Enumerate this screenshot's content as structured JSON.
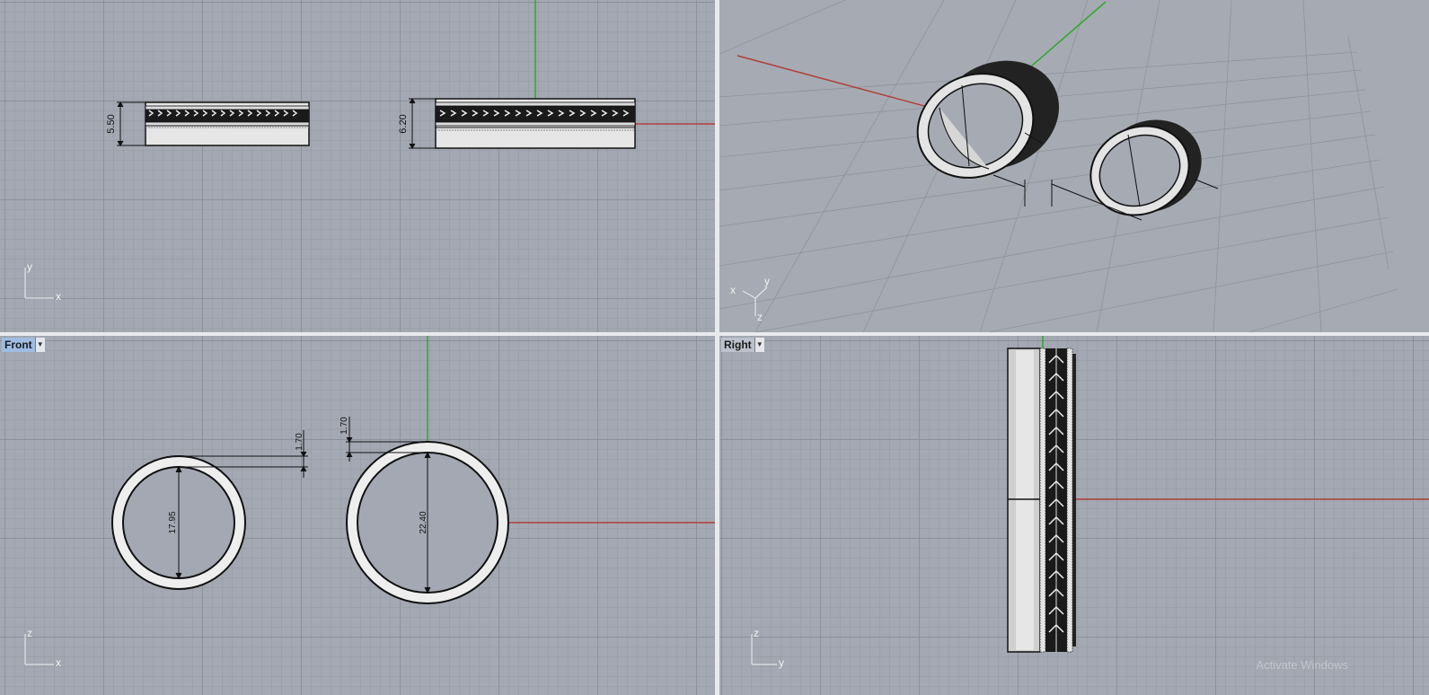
{
  "viewports": {
    "top": {
      "label": "",
      "axes": {
        "h": "x",
        "v": "y"
      }
    },
    "perspective": {
      "label": "",
      "axes": {
        "a": "x",
        "b": "y",
        "c": "z"
      }
    },
    "front": {
      "label": "Front",
      "axes": {
        "h": "x",
        "v": "z"
      }
    },
    "right": {
      "label": "Right",
      "axes": {
        "h": "y",
        "v": "z"
      }
    }
  },
  "dimensions": {
    "top_small_height": "5.50",
    "top_large_height": "6.20",
    "front_small_thickness": "1.70",
    "front_large_thickness": "1.70",
    "front_small_diameter": "17.95",
    "front_large_diameter": "22.40"
  },
  "watermark": "Activate Windows",
  "colors": {
    "viewport_bg": "#a3a8b2",
    "x_axis": "#b0403a",
    "y_axis": "#2fa82f",
    "active_label": "#9fbde3"
  }
}
